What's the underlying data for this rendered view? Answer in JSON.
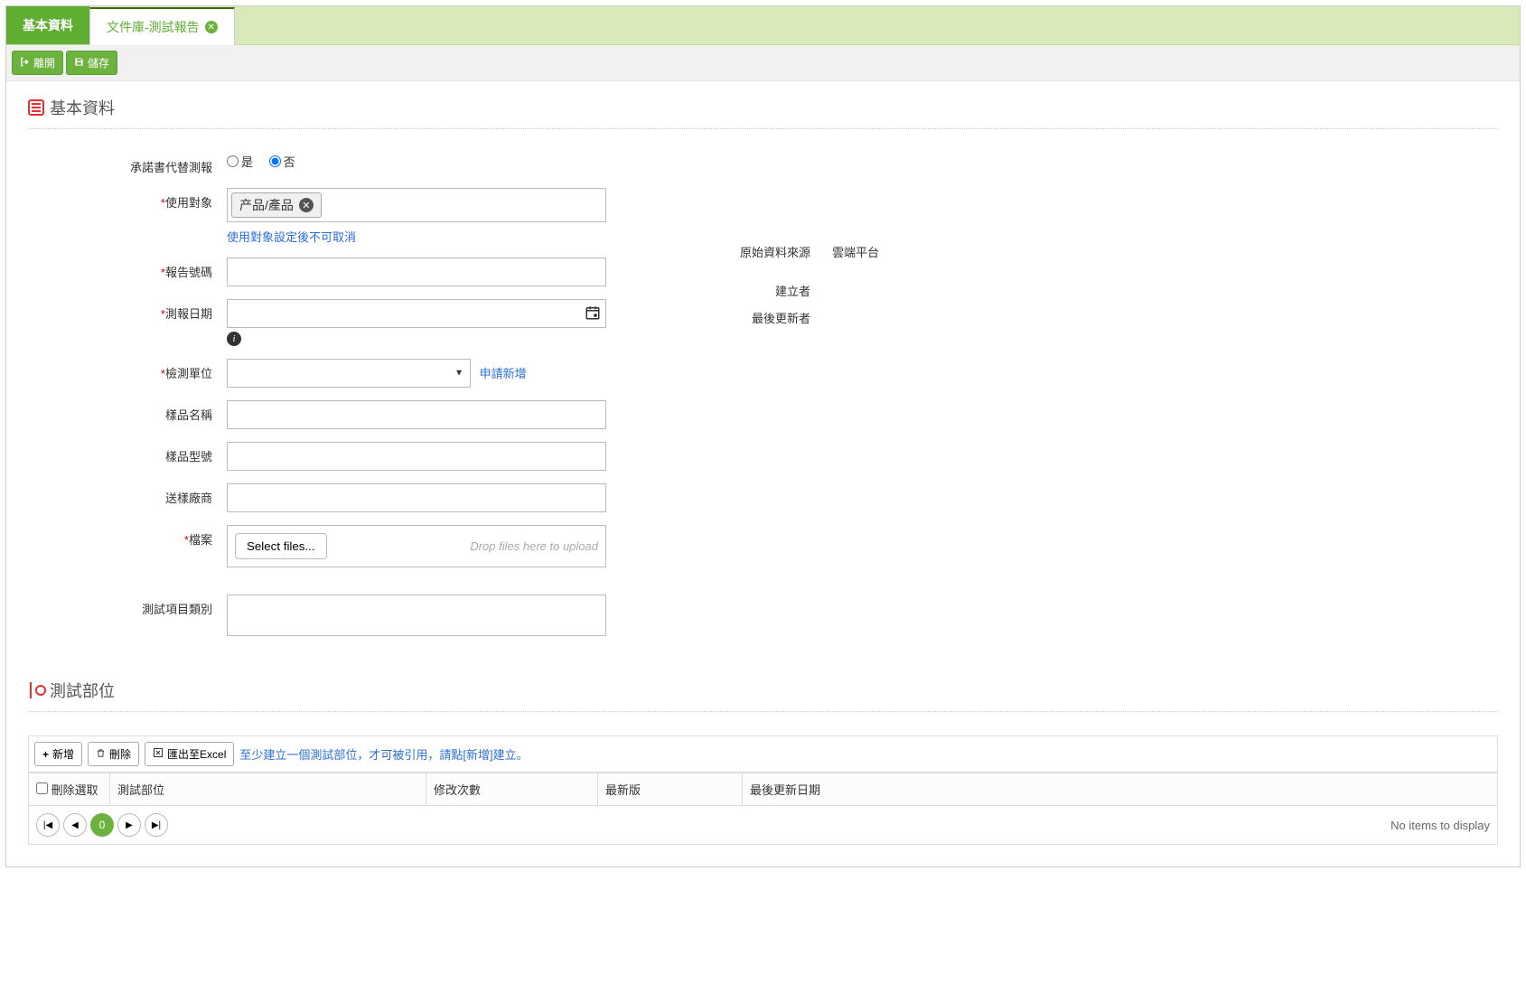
{
  "tabs": {
    "basic": "基本資料",
    "active": "文件庫-測試報告"
  },
  "actions": {
    "leave": "離開",
    "save": "儲存"
  },
  "sections": {
    "basic": "基本資料",
    "testPart": "測試部位"
  },
  "form": {
    "substituteLabel": "承諾書代替測報",
    "radioYes": "是",
    "radioNo": "否",
    "targetLabel": "使用對象",
    "targetChip": "产品/產品",
    "targetHelp": "使用對象設定後不可取消",
    "reportNoLabel": "報告號碼",
    "reportDateLabel": "測報日期",
    "inspectUnitLabel": "檢測單位",
    "applyNewLink": "申請新增",
    "sampleNameLabel": "樣品名稱",
    "sampleModelLabel": "樣品型號",
    "senderLabel": "送樣廠商",
    "fileLabel": "檔案",
    "selectFilesBtn": "Select files...",
    "dropHint": "Drop files here to upload",
    "testItemCatLabel": "測試項目類別"
  },
  "meta": {
    "sourceLabel": "原始資料來源",
    "sourceVal": "雲端平台",
    "creatorLabel": "建立者",
    "creatorVal": "",
    "updaterLabel": "最後更新者",
    "updaterVal": ""
  },
  "gridToolbar": {
    "add": "新增",
    "delete": "刪除",
    "export": "匯出至Excel",
    "hint": "至少建立一個測試部位，才可被引用，請點[新增]建立。"
  },
  "gridHeaders": {
    "deleteSel": "刪除選取",
    "part": "測試部位",
    "modCount": "修改次數",
    "latest": "最新版",
    "lastUpdate": "最後更新日期"
  },
  "pager": {
    "current": "0",
    "noItems": "No items to display"
  }
}
